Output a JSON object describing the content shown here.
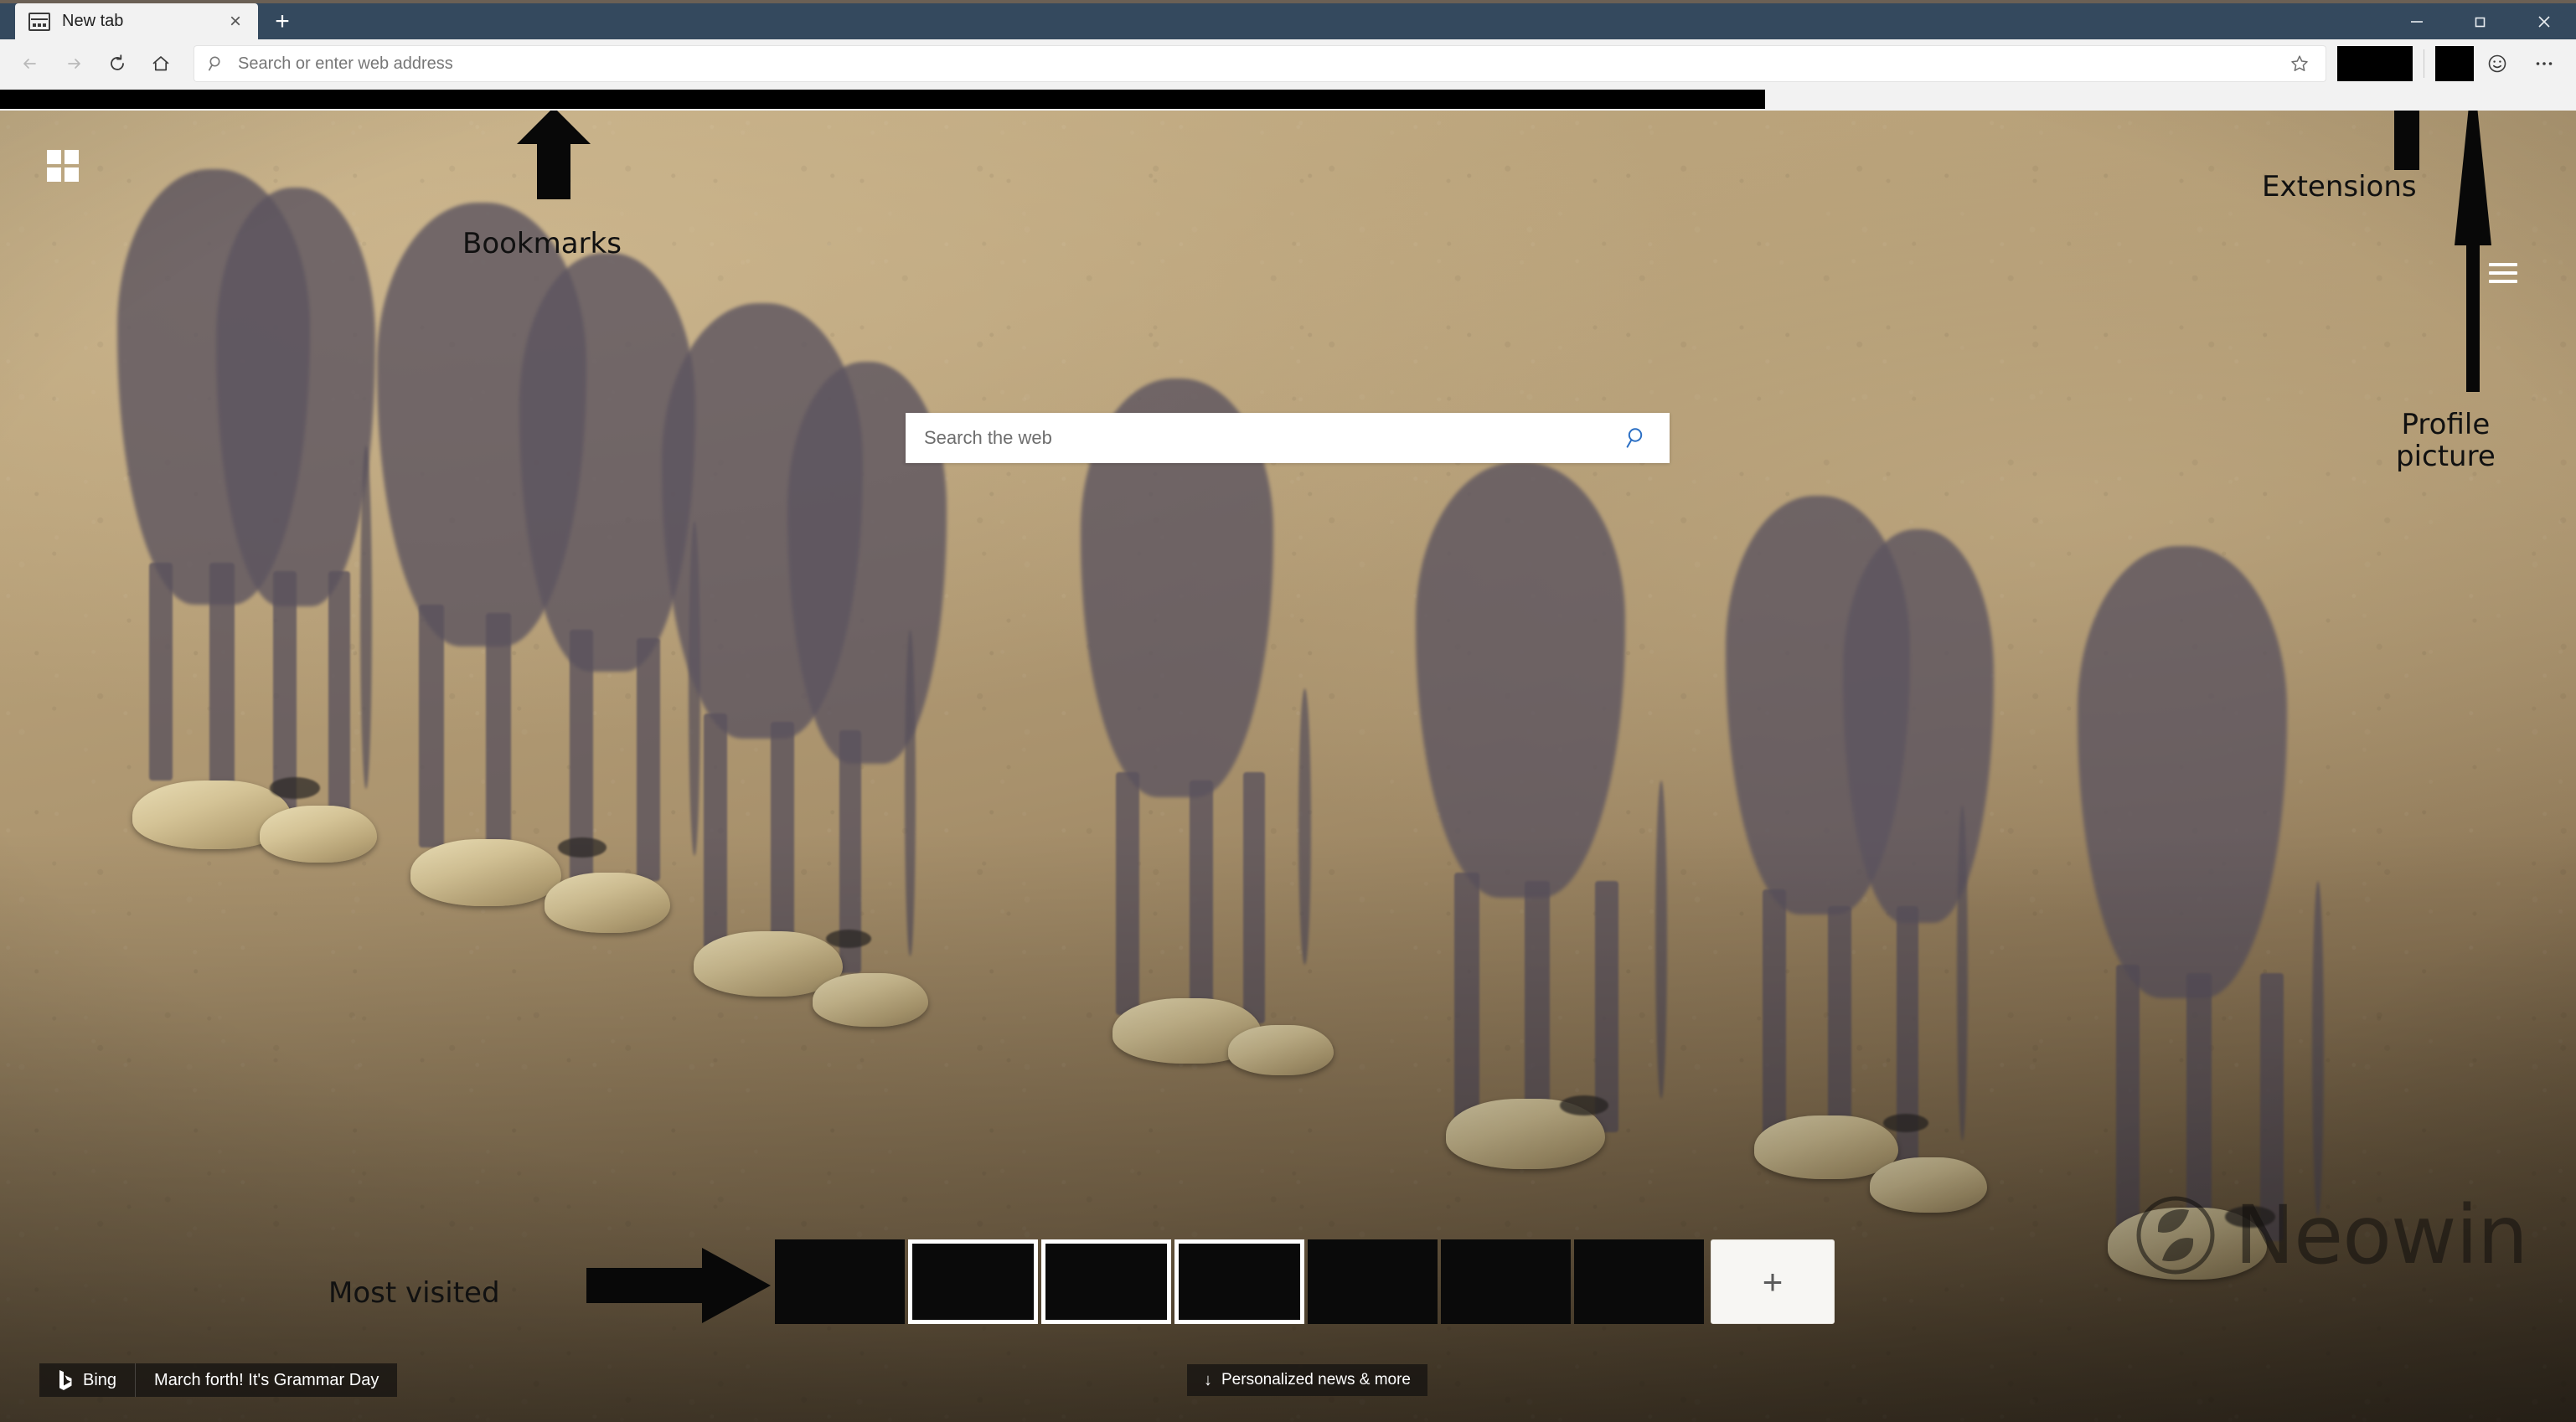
{
  "browser": {
    "tab": {
      "title": "New tab",
      "favicon_name": "newtab-favicon",
      "close_label": "×"
    },
    "new_tab_button_label": "+",
    "window_controls": {
      "minimize_label": "Minimize",
      "maximize_label": "Maximize",
      "close_label": "Close"
    },
    "toolbar": {
      "back_label": "Back",
      "forward_label": "Forward",
      "refresh_label": "Refresh",
      "home_label": "Home",
      "address_placeholder": "Search or enter web address",
      "favorite_label": "Add to favorites",
      "extensions_redacted": "",
      "profile_redacted": "",
      "feedback_label": "Send feedback",
      "settings_label": "Settings and more"
    },
    "bookmarks_bar": {
      "redacted": ""
    }
  },
  "newtab": {
    "app_launcher_label": "App launcher",
    "page_menu_label": "Page settings",
    "search": {
      "placeholder": "Search the web",
      "icon_name": "search-icon",
      "accent": "#2b6fc4"
    },
    "tiles": {
      "items": [
        {
          "name": "tile-1",
          "framed": false,
          "label": ""
        },
        {
          "name": "tile-2",
          "framed": true,
          "label": ""
        },
        {
          "name": "tile-3",
          "framed": true,
          "label": ""
        },
        {
          "name": "tile-4",
          "framed": true,
          "label": ""
        },
        {
          "name": "tile-5",
          "framed": false,
          "label": ""
        },
        {
          "name": "tile-6",
          "framed": false,
          "label": ""
        },
        {
          "name": "tile-7",
          "framed": false,
          "label": ""
        }
      ],
      "add_tile_label": "+"
    },
    "bing": {
      "brand": "Bing",
      "headline": "March forth! It's Grammar Day"
    },
    "news": {
      "arrow": "↓",
      "label": "Personalized news & more"
    },
    "watermark": {
      "text": "Neowin"
    }
  },
  "annotations": [
    {
      "id": "bookmarks",
      "label": "Bookmarks",
      "arrow": "up"
    },
    {
      "id": "extensions",
      "label": "Extensions",
      "arrow": "up"
    },
    {
      "id": "profile",
      "label": "Profile\npicture",
      "arrow": "up"
    },
    {
      "id": "most",
      "label": "Most visited",
      "arrow": "right"
    }
  ],
  "colors": {
    "titlebar": "#34495e",
    "toolbar": "#f2f2f2",
    "annotation_ink": "#111111",
    "redaction": "#000000",
    "sand": "#b9a27a",
    "shadow": "#5d5560"
  }
}
